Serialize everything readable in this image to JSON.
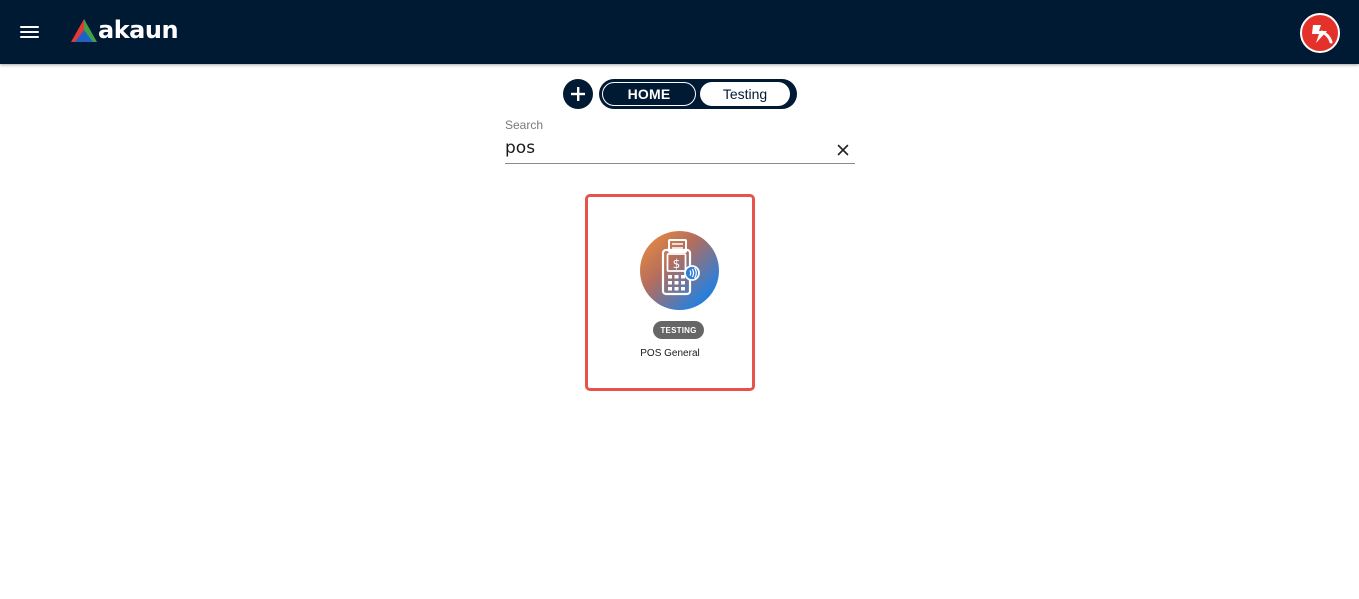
{
  "header": {
    "logo_text": "akaun",
    "menu_icon": "hamburger-menu-icon",
    "avatar_icon": "user-avatar-icon",
    "colors": {
      "background": "#001a33",
      "avatar": "#e4322b"
    }
  },
  "tabs": {
    "add_icon": "plus-icon",
    "items": [
      {
        "label": "HOME",
        "active": false
      },
      {
        "label": "Testing",
        "active": true
      }
    ]
  },
  "search": {
    "label": "Search",
    "value": "pos",
    "clear_icon": "close-icon"
  },
  "apps": [
    {
      "name": "POS General",
      "badge": "TESTING",
      "icon": "pos-terminal-icon",
      "selected": true,
      "highlight_color": "#e5534b"
    }
  ]
}
